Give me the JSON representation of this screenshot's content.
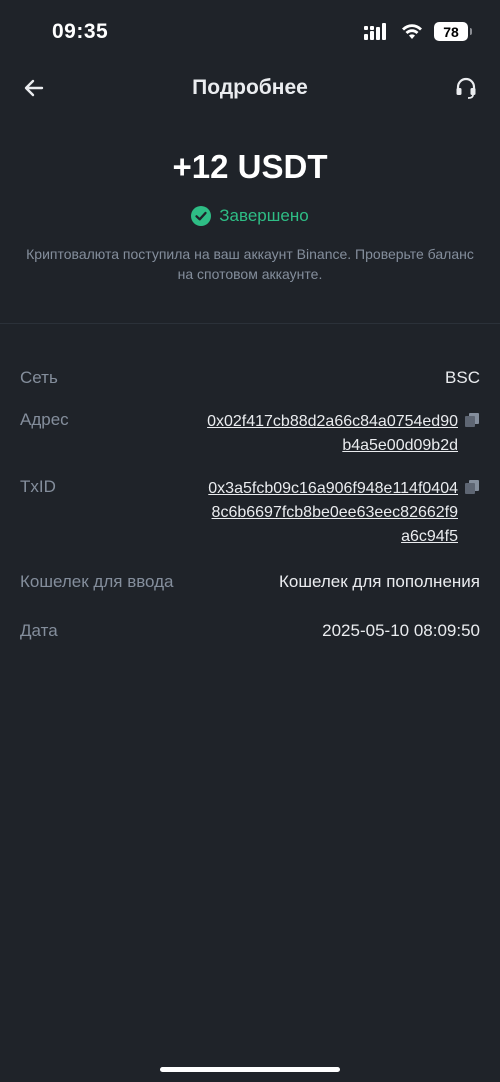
{
  "status_bar": {
    "time": "09:35",
    "battery": "78"
  },
  "nav": {
    "title": "Подробнее"
  },
  "transaction": {
    "amount": "+12 USDT",
    "status": "Завершено",
    "description": "Криптовалюта поступила на ваш аккаунт Binance. Проверьте баланс на спотовом аккаунте."
  },
  "details": {
    "network": {
      "label": "Сеть",
      "value": "BSC"
    },
    "address": {
      "label": "Адрес",
      "value": "0x02f417cb88d2a66c84a0754ed90b4a5e00d09b2d"
    },
    "txid": {
      "label": "TxID",
      "value": "0x3a5fcb09c16a906f948e114f04048c6b6697fcb8be0ee63eec82662f9a6c94f5"
    },
    "wallet": {
      "label": "Кошелек для ввода",
      "value": "Кошелек для пополнения"
    },
    "date": {
      "label": "Дата",
      "value": "2025-05-10 08:09:50"
    }
  },
  "colors": {
    "background": "#1f2329",
    "success": "#2ebd85",
    "muted": "#848e9c"
  },
  "icons": [
    "back-arrow-icon",
    "headset-icon",
    "check-circle-icon",
    "copy-icon",
    "signal-icon",
    "wifi-icon",
    "battery-icon"
  ]
}
